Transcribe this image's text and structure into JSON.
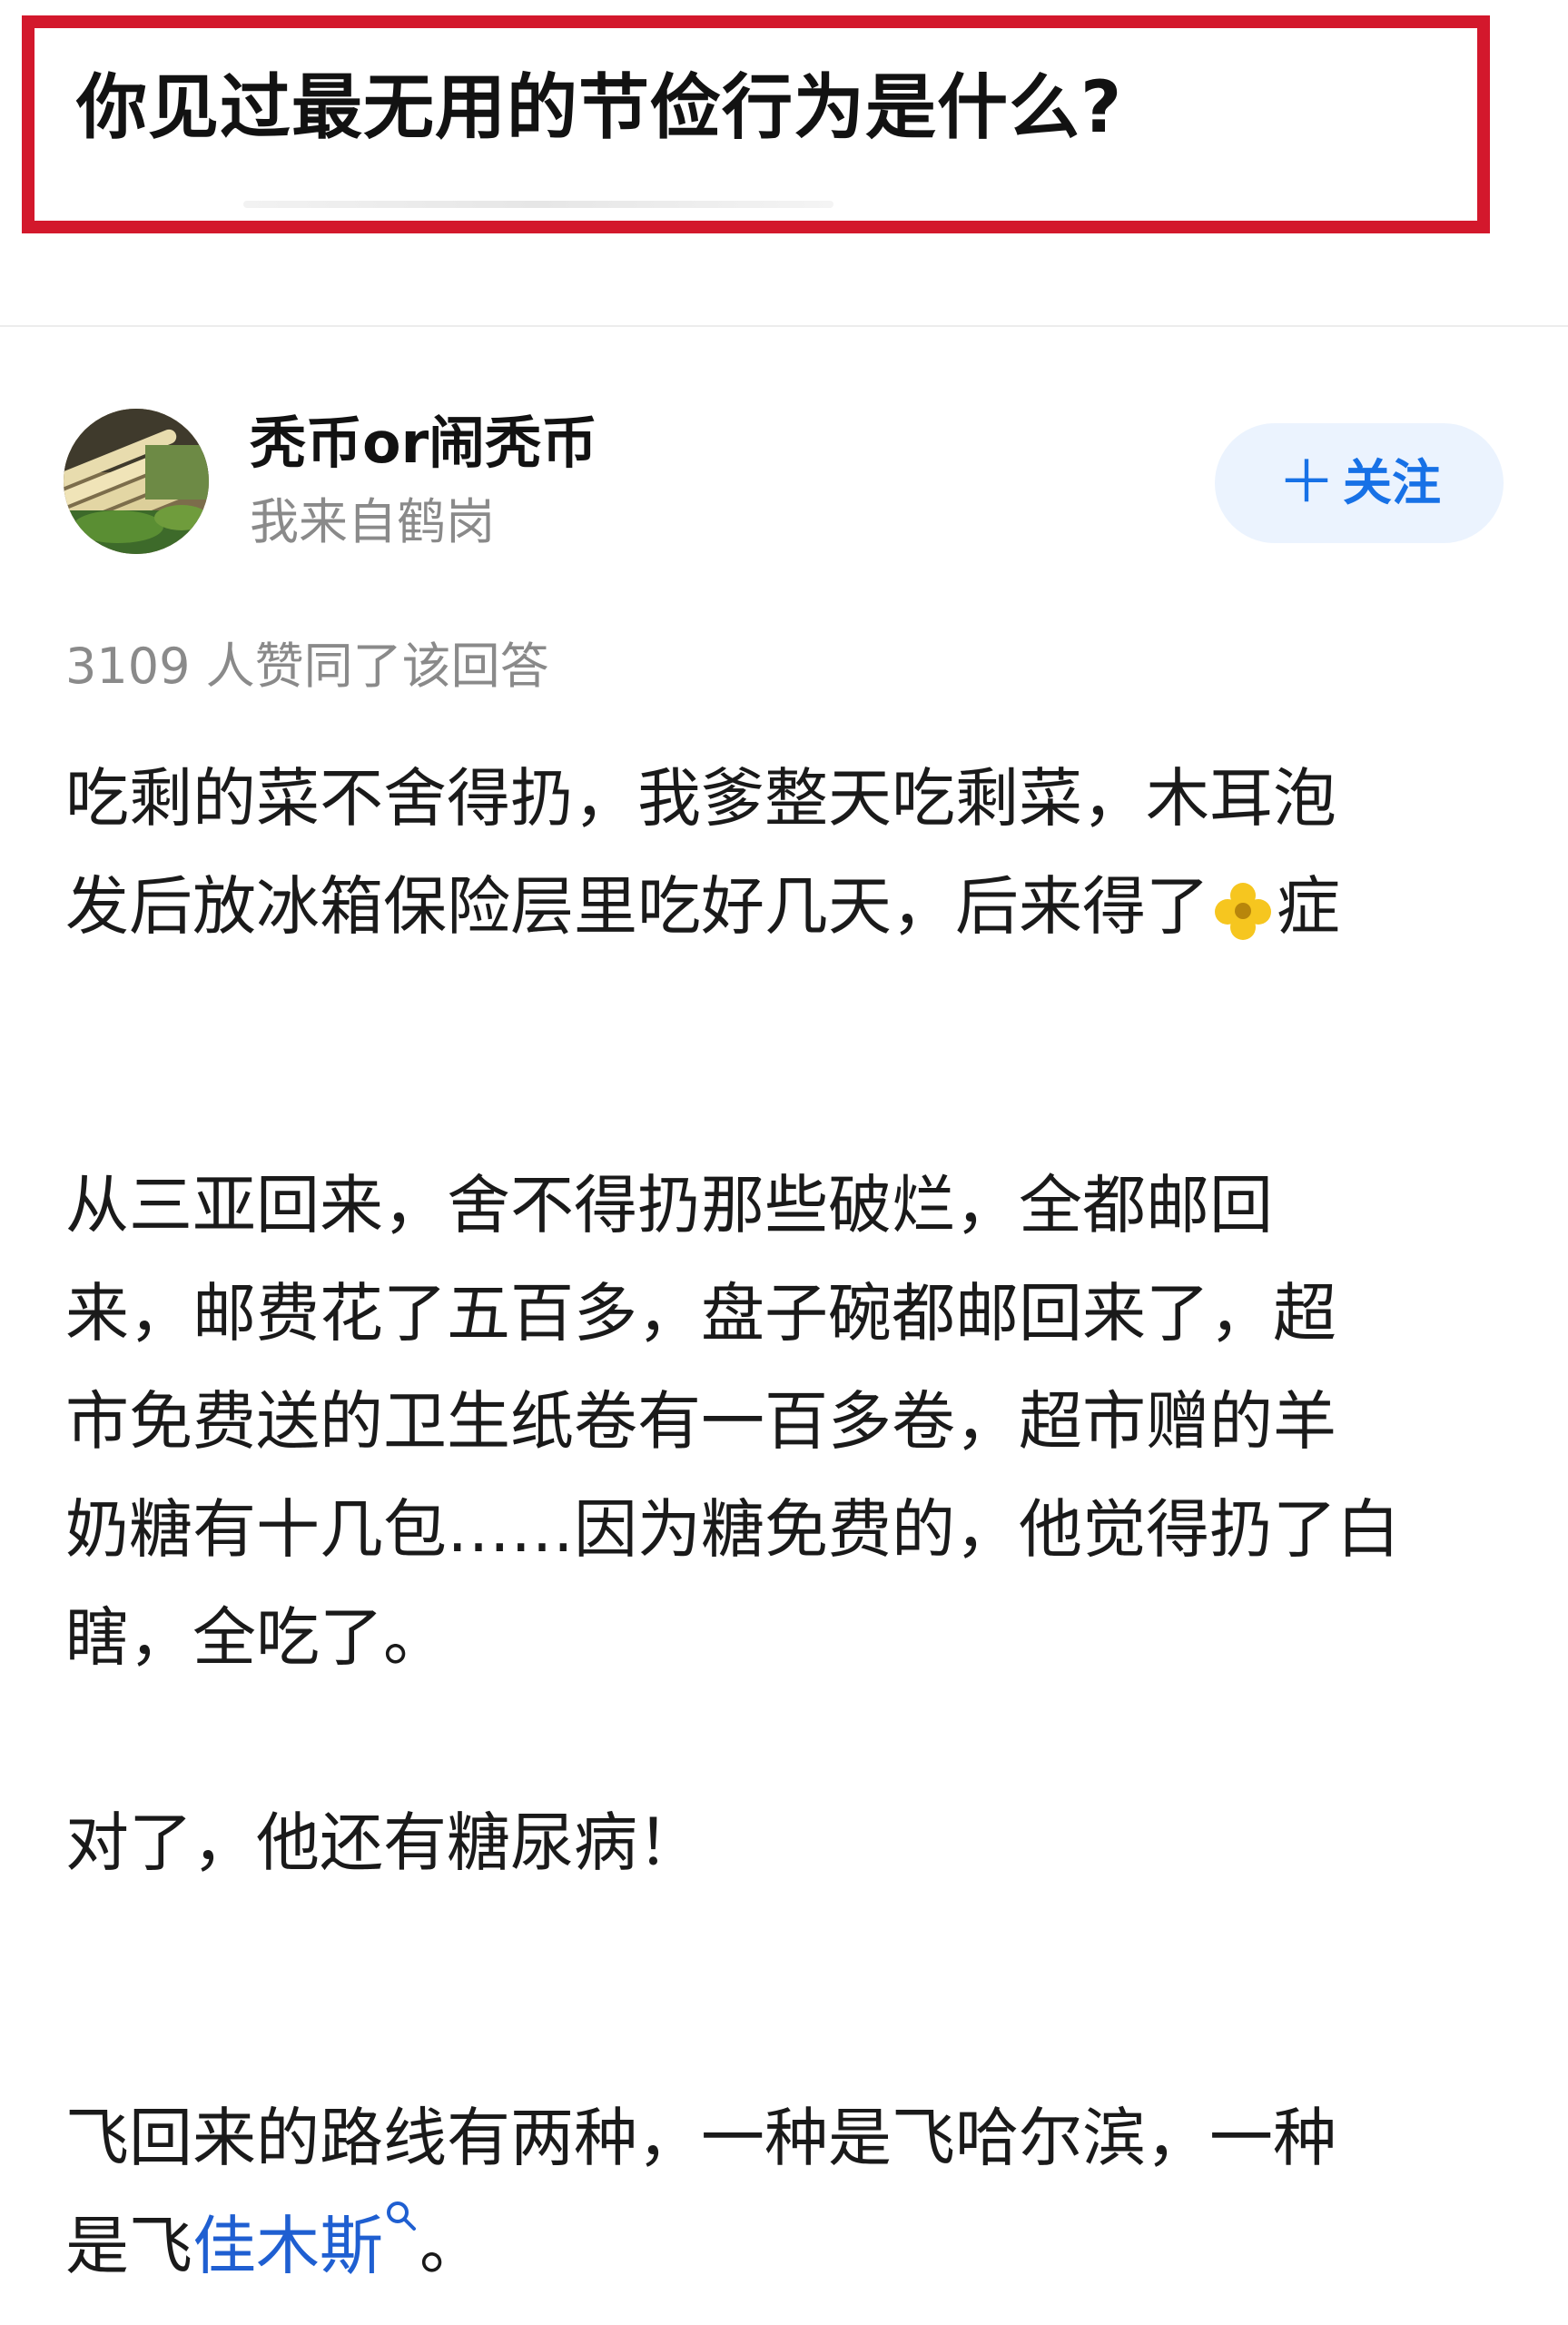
{
  "question": {
    "title": "你见过最无用的节俭行为是什么?"
  },
  "author": {
    "name": "秃币or闹秃币",
    "bio": "我来自鹤岗",
    "follow_label": "关注",
    "follow_plus": "＋"
  },
  "answer": {
    "vote_summary": "3109 人赞同了该回答",
    "p1_line1": "吃剩的菜不舍得扔，我爹整天吃剩菜，木耳泡",
    "p1_line2_before": "发后放冰箱保险层里吃好几天，后来得了",
    "p1_line2_after": "症",
    "p2_line1": "从三亚回来，舍不得扔那些破烂，全都邮回",
    "p2_line2": "来，邮费花了五百多，盘子碗都邮回来了，超",
    "p2_line3": "市免费送的卫生纸卷有一百多卷，超市赠的羊",
    "p2_line4": "奶糖有十几包……因为糖免费的，他觉得扔了白",
    "p2_line5": "瞎，全吃了。",
    "p3_line1": "对了，他还有糖尿病！",
    "p4_line1": "飞回来的路线有两种，一种是飞哈尔滨，一种",
    "p4_line2_before": "是飞",
    "p4_link": "佳木斯",
    "p4_line2_after": "。"
  },
  "colors": {
    "highlight_border": "#d3182c",
    "follow_text": "#1771e6",
    "follow_bg": "#ebf3fe",
    "link": "#1f5fd1",
    "muted_text": "#8a8a8a"
  },
  "icons": {
    "flower": "flower-emoji-icon",
    "search": "search-icon",
    "plus": "plus-icon"
  }
}
